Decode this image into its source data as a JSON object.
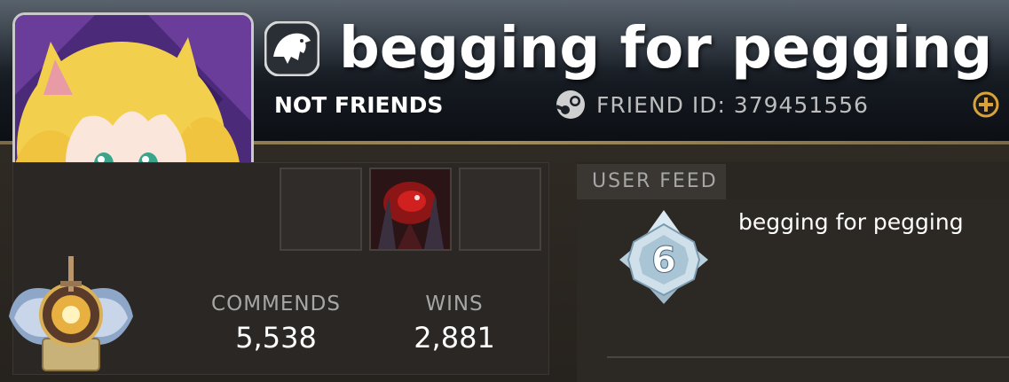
{
  "profile": {
    "player_name": "begging for pegging",
    "relationship_status": "NOT FRIENDS",
    "friend_id_label": "FRIEND ID: 379451556"
  },
  "icons": {
    "team_logo": "team-logo-icon",
    "steam": "steam-icon",
    "add_friend": "plus-icon",
    "rank_medal": "rank-medal-icon",
    "feed_badge": "level-badge-icon"
  },
  "hero_slots": [
    {
      "state": "empty"
    },
    {
      "state": "hero"
    },
    {
      "state": "empty"
    }
  ],
  "stats": {
    "commends_label": "COMMENDS",
    "commends_value": "5,538",
    "wins_label": "WINS",
    "wins_value": "2,881"
  },
  "feed": {
    "tab_label": "USER FEED",
    "badge_number": "6",
    "entry_text": "begging for pegging"
  },
  "colors": {
    "accent_gold": "#a08b5a",
    "plus_gold": "#d9a23a",
    "avatar_bg": "#4b2a7a"
  }
}
